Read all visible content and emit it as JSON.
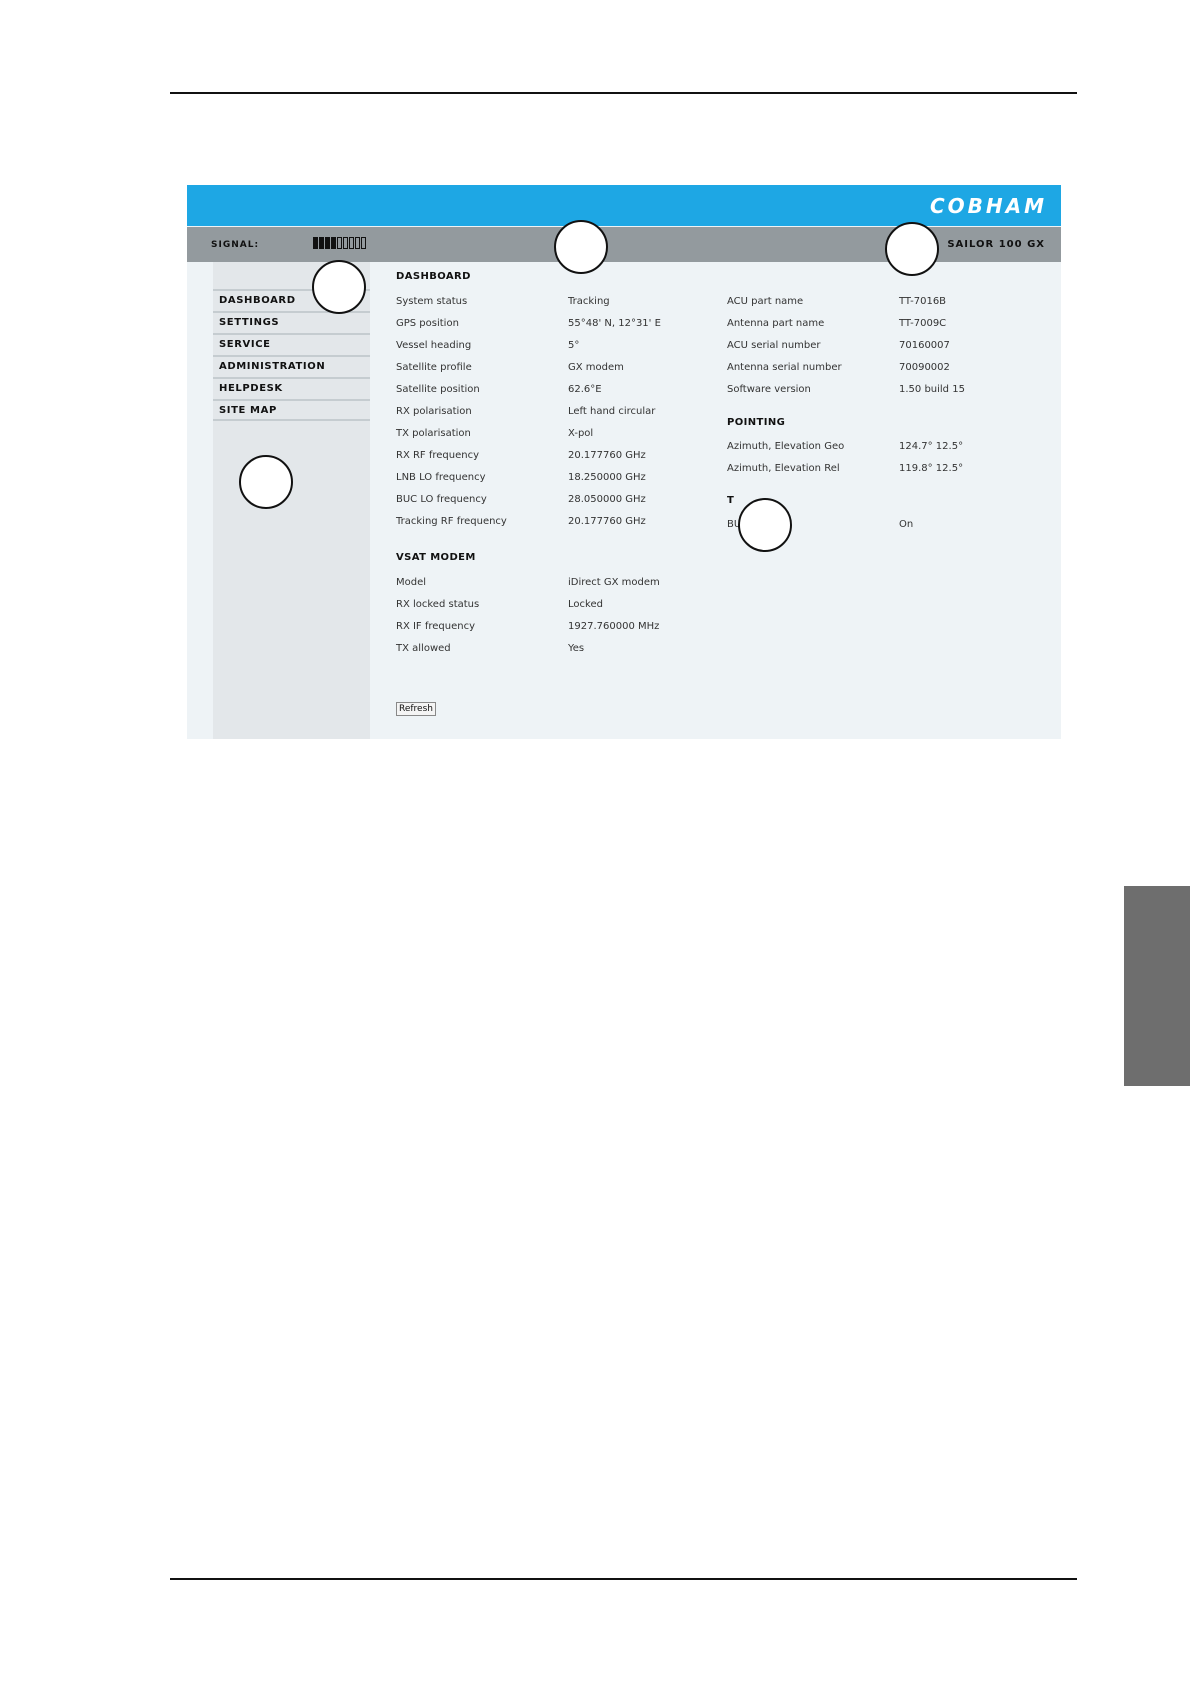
{
  "app": {
    "logo_text": "COBHAM",
    "product_name": "SAILOR 100 GX",
    "signal": {
      "label": "SIGNAL:",
      "level": 4,
      "total": 9
    }
  },
  "sidebar": {
    "items": [
      {
        "label": "DASHBOARD"
      },
      {
        "label": "SETTINGS"
      },
      {
        "label": "SERVICE"
      },
      {
        "label": "ADMINISTRATION"
      },
      {
        "label": "HELPDESK"
      },
      {
        "label": "SITE MAP"
      }
    ]
  },
  "dashboard": {
    "title": "DASHBOARD",
    "rows": [
      {
        "key": "System status",
        "value": "Tracking"
      },
      {
        "key": "GPS position",
        "value": "55°48' N, 12°31' E"
      },
      {
        "key": "Vessel heading",
        "value": "5°"
      },
      {
        "key": "Satellite profile",
        "value": "GX modem"
      },
      {
        "key": "Satellite position",
        "value": "62.6°E"
      },
      {
        "key": "RX polarisation",
        "value": "Left hand circular"
      },
      {
        "key": "TX polarisation",
        "value": "X-pol"
      },
      {
        "key": "RX RF frequency",
        "value": "20.177760 GHz"
      },
      {
        "key": "LNB LO frequency",
        "value": "18.250000 GHz"
      },
      {
        "key": "BUC LO frequency",
        "value": "28.050000 GHz"
      },
      {
        "key": "Tracking RF frequency",
        "value": "20.177760 GHz"
      }
    ]
  },
  "vsat_modem": {
    "title": "VSAT MODEM",
    "rows": [
      {
        "key": "Model",
        "value": "iDirect GX modem"
      },
      {
        "key": "RX locked status",
        "value": "Locked"
      },
      {
        "key": "RX IF frequency",
        "value": "1927.760000 MHz"
      },
      {
        "key": "TX allowed",
        "value": "Yes"
      }
    ]
  },
  "info": {
    "rows": [
      {
        "key": "ACU part name",
        "value": "TT-7016B"
      },
      {
        "key": "Antenna part name",
        "value": "TT-7009C"
      },
      {
        "key": "ACU serial number",
        "value": "70160007"
      },
      {
        "key": "Antenna serial number",
        "value": "70090002"
      },
      {
        "key": "Software version",
        "value": "1.50 build 15"
      }
    ]
  },
  "pointing": {
    "title": "POINTING",
    "rows": [
      {
        "key": "Azimuth, Elevation Geo",
        "value": "124.7° 12.5°"
      },
      {
        "key": "Azimuth, Elevation Rel",
        "value": "119.8° 12.5°"
      }
    ]
  },
  "tx": {
    "title": "T",
    "rows": [
      {
        "key": "BUC",
        "value": "On"
      }
    ]
  },
  "actions": {
    "refresh_label": "Refresh"
  }
}
